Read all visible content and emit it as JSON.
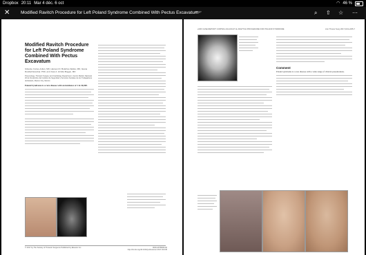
{
  "status": {
    "app": "Dropbox",
    "time": "20:11",
    "date": "Mar 4 déc. 6 oct",
    "battery": "46 %"
  },
  "toolbar": {
    "title": "Modified Ravitch Procedure for Left Poland Syndrome Combined With Pectus Excavatum",
    "badge": "PDF"
  },
  "left_page": {
    "title": "Modified Ravitch Procedure for Left Poland Syndrome Combined With Pectus Excavatum",
    "authors": "Gilsante Cortes-Julian, MD, Hanseni D. Bolaños-Valdés, MD, Ileana Rosibell Escobar, PhD, and José A. Hirrida Boggio, MD",
    "affiliation": "Pneumology, Thoracic Surgery and Cardiology Department, Centro Medico Nacional 20 de Noviembre del Instituto de Seguridad y Servicios Sociales de los Trabajadores del Estado, Mexico City, Mexico",
    "abstract_start": "Poland Syndrome is a rare disease with an incidence of 1 in 30,000.",
    "footer_left": "© 2017 by The Society of Thoracic Surgeons Published by Elsevier Inc.",
    "footer_right": "0003-4975/$36.00 http://dx.doi.org/10.1016/j.athoracsur.2017.04.045"
  },
  "right_page": {
    "header_left": "e336 CASE REPORT CORTES-JULIAN ET AL RAVITCH PROCEDURE FOR POLAND SYNDROME",
    "header_right": "Ann Thorac Surg 2017;104:e335-7",
    "comment_heading": "Comment",
    "comment_start": "Poland syndrome is a rare disease with a wide range of clinical presentations."
  }
}
